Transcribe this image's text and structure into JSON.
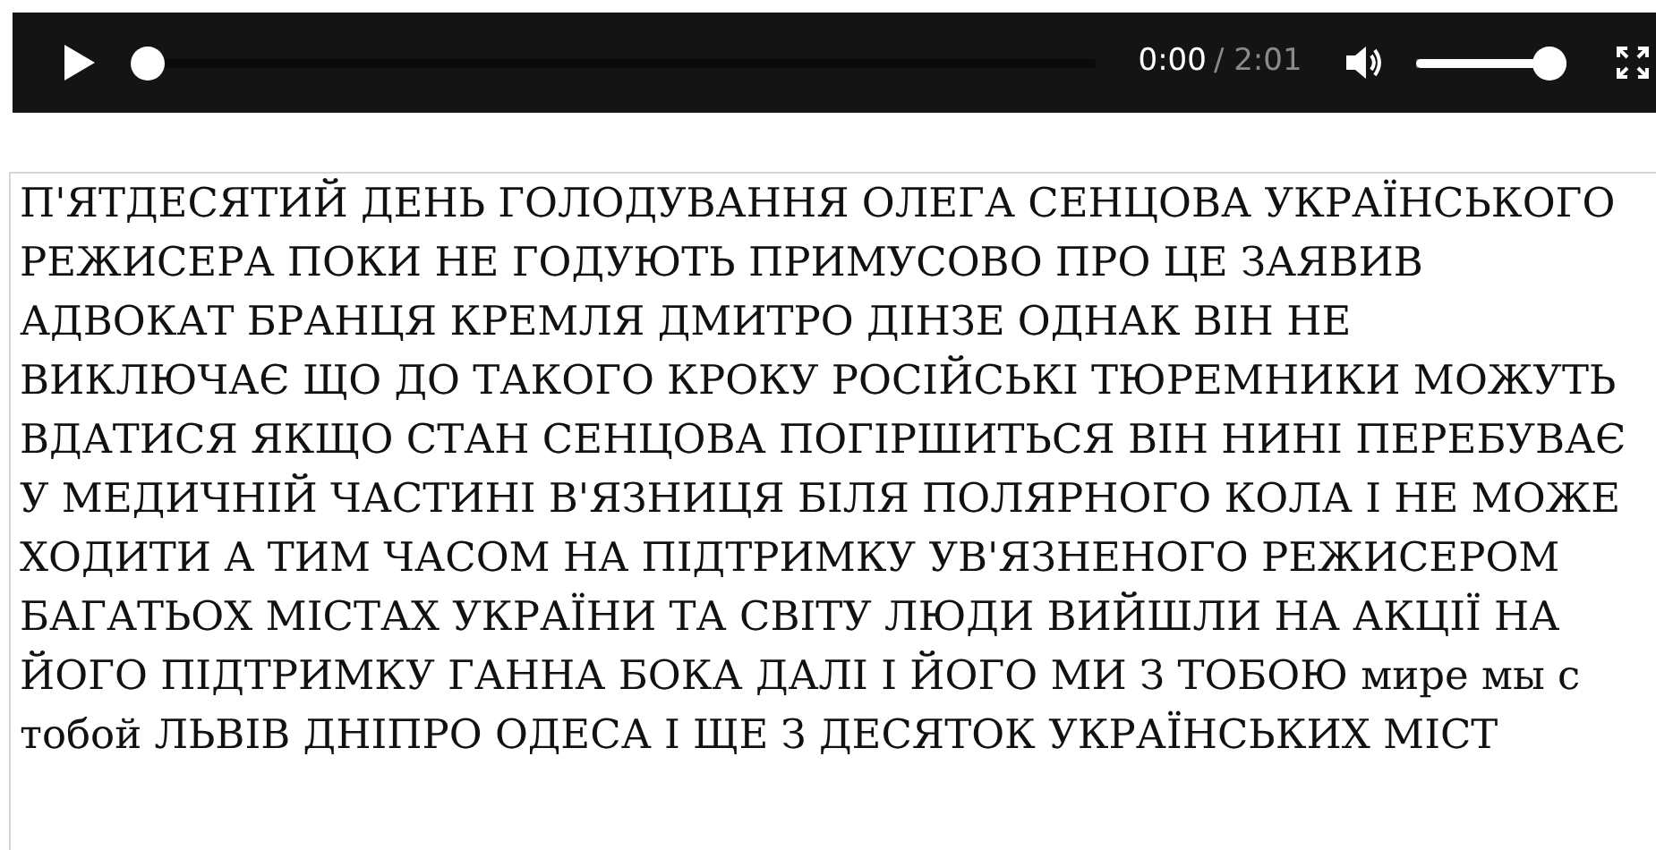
{
  "player": {
    "playing": false,
    "level": 0.0,
    "current_time": "0:00",
    "duration": "/ 2:01",
    "muted": false,
    "volume": {
      "level": 1.0
    }
  },
  "transcript": {
    "lines": [
      "П'ЯТДЕСЯТИЙ ДЕНЬ ГОЛОДУВАННЯ ОЛЕГА СЕНЦОВА УКРАЇНСЬКОГО",
      "РЕЖИСЕРА ПОКИ НЕ ГОДУЮТЬ ПРИМУСОВО ПРО ЦЕ ЗАЯВИВ",
      "АДВОКАТ БРАНЦЯ КРЕМЛЯ ДМИТРО ДІНЗЕ ОДНАК ВІН НЕ",
      "ВИКЛЮЧАЄ ЩО ДО ТАКОГО КРОКУ РОСІЙСЬКІ ТЮРЕМНИКИ МОЖУТЬ",
      "ВДАТИСЯ ЯКЩО СТАН СЕНЦОВА ПОГІРШИТЬСЯ ВІН НИНІ ПЕРЕБУВАЄ",
      "У МЕДИЧНІЙ ЧАСТИНІ В'ЯЗНИЦЯ БІЛЯ ПОЛЯРНОГО КОЛА І НЕ МОЖЕ",
      "ХОДИТИ А ТИМ ЧАСОМ НА ПІДТРИМКУ УВ'ЯЗНЕНОГО РЕЖИСЕРОМ",
      "БАГАТЬОХ МІСТАХ УКРАЇНИ ТА СВІТУ ЛЮДИ ВИЙШЛИ НА АКЦІЇ НА",
      "ЙОГО ПІДТРИМКУ ГАННА БОКА ДАЛІ І ЙОГО МИ З ТОБОЮ мире мы с",
      "тобой ЛЬВІВ ДНІПРО ОДЕСА І ЩЕ З ДЕСЯТОК УКРАЇНСЬКИХ МІСТ"
    ]
  }
}
